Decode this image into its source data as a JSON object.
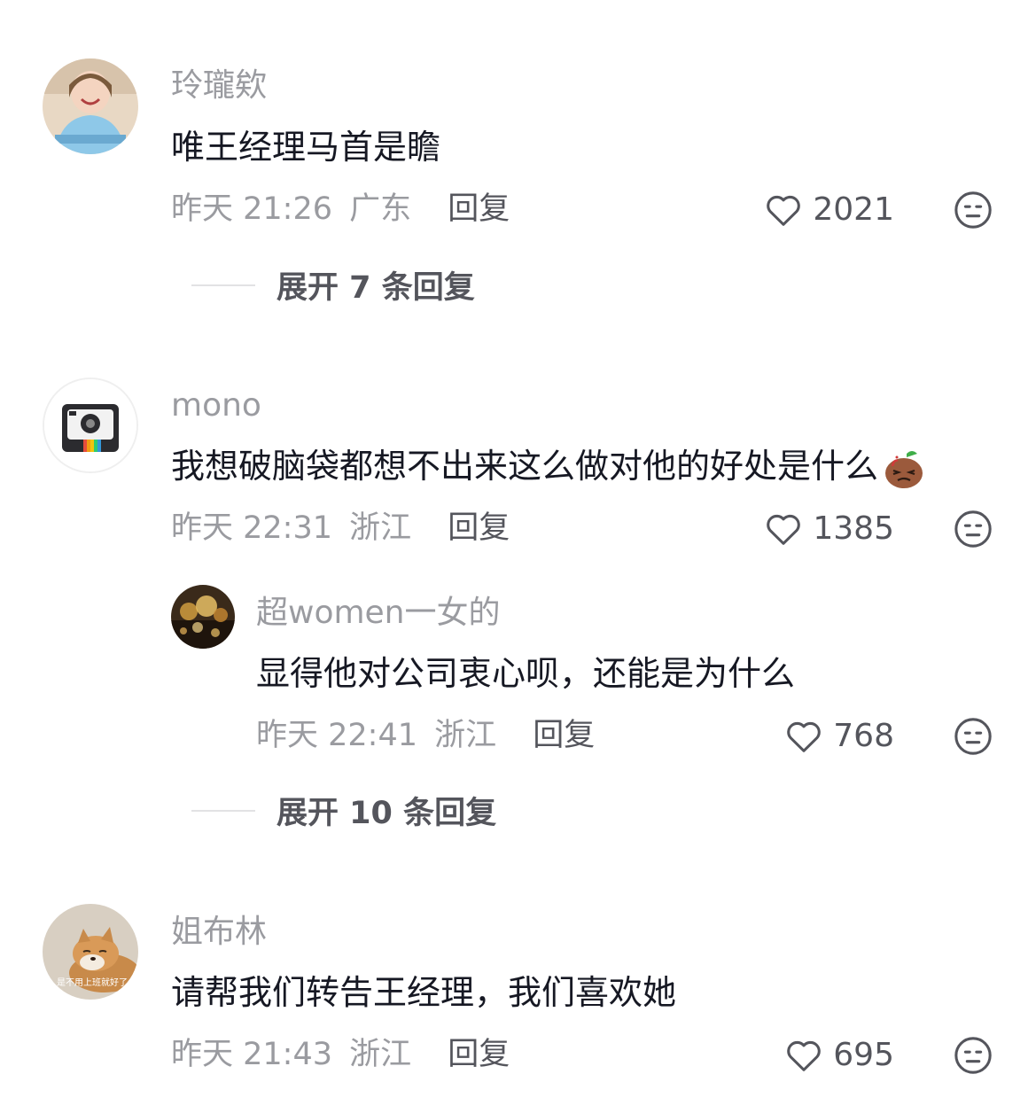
{
  "comments": [
    {
      "username": "玲瓏欸",
      "avatar_icon": "girl-photo-avatar",
      "text": "唯王经理马首是瞻",
      "time": "昨天 21:26",
      "location": "广东",
      "reply_label": "回复",
      "likes": "2021",
      "expand_label": "展开 7 条回复"
    },
    {
      "username": "mono",
      "avatar_icon": "camera-avatar",
      "text": "我想破脑袋都想不出来这么做对他的好处是什么",
      "emoji": "confused-potato-emoji",
      "time": "昨天 22:31",
      "location": "浙江",
      "reply_label": "回复",
      "likes": "1385",
      "reply": {
        "username": "超women一女的",
        "avatar_icon": "golden-lights-avatar",
        "text": "显得他对公司衷心呗，还能是为什么",
        "time": "昨天 22:41",
        "location": "浙江",
        "reply_label": "回复",
        "likes": "768"
      },
      "expand_label": "展开 10 条回复"
    },
    {
      "username": "姐布林",
      "avatar_icon": "shiba-dog-avatar",
      "avatar_caption": "是不用上班就好了",
      "text": "请帮我们转告王经理，我们喜欢她",
      "time": "昨天 21:43",
      "location": "浙江",
      "reply_label": "回复",
      "likes": "695"
    }
  ],
  "colors": {
    "text_primary": "#161823",
    "text_secondary": "#9a9ba0",
    "text_action": "#54555c"
  }
}
